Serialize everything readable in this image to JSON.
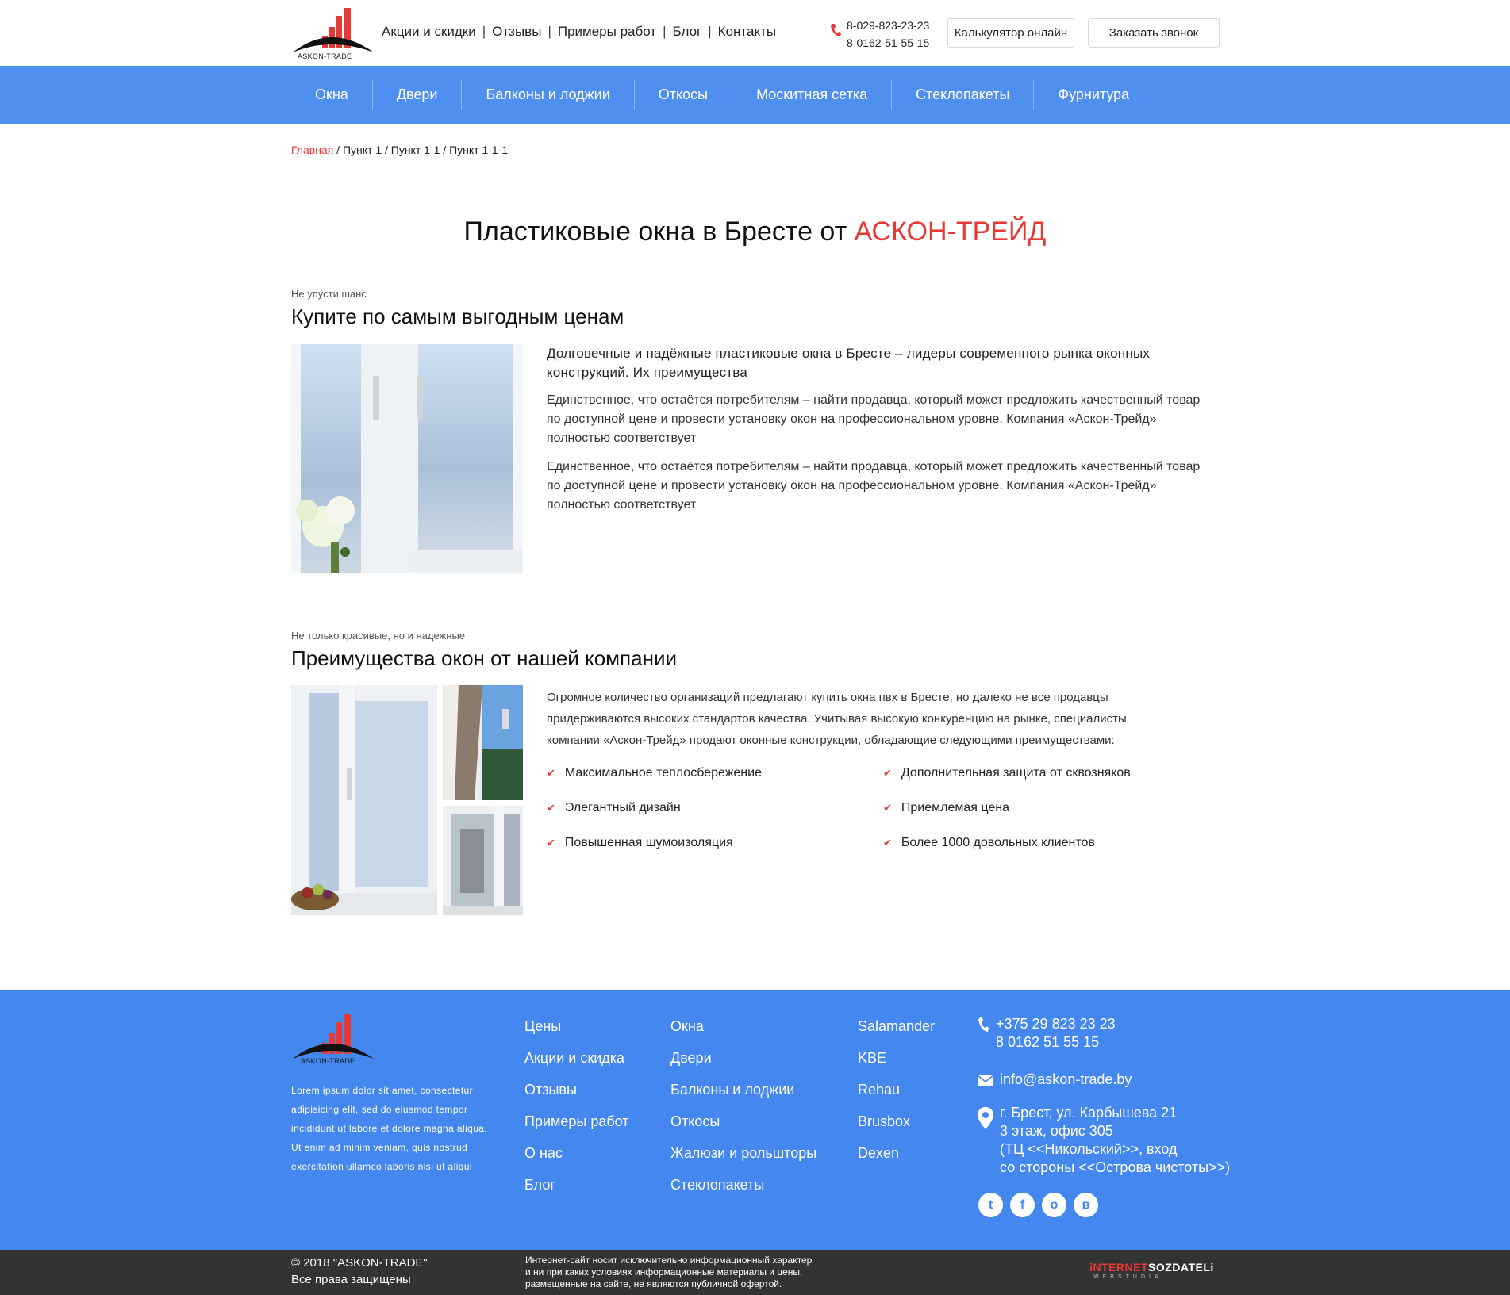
{
  "brand": {
    "logo_text": "ASKON-TRADE"
  },
  "header": {
    "top_links": [
      "Акции и скидки",
      "Отзывы",
      "Примеры работ",
      "Блог",
      "Контакты"
    ],
    "phones": [
      "8-029-823-23-23",
      "8-0162-51-55-15"
    ],
    "calc_button": "Калькулятор онлайн",
    "callback_button": "Заказать звонок"
  },
  "nav": [
    "Окна",
    "Двери",
    "Балконы и лоджии",
    "Откосы",
    "Москитная сетка",
    "Стеклопакеты",
    "Фурнитура"
  ],
  "breadcrumb": {
    "home": "Главная",
    "rest": " / Пункт 1 / Пункт 1-1 / Пункт 1-1-1"
  },
  "main": {
    "title": "Пластиковые окна в Бресте от ",
    "title_accent": "АСКОН-ТРЕЙД"
  },
  "section1": {
    "kicker": "Не упусти шанс",
    "title": "Купите по самым выгодным ценам",
    "lead": "Долговечные и надёжные пластиковые окна в Бресте – лидеры современного рынка оконных конструкций. Их преимущества",
    "p1": "Единственное, что остаётся потребителям – найти продавца, который может предложить качественный товар по доступной цене и провести установку окон на профессиональном уровне. Компания «Аскон-Трейд» полностью соответствует",
    "p2": "Единственное, что остаётся потребителям – найти продавца, который может предложить качественный товар по доступной цене и провести установку окон на профессиональном уровне. Компания «Аскон-Трейд» полностью соответствует"
  },
  "section2": {
    "kicker": "Не только красивые, но и надежные",
    "title": "Преимущества окон от нашей компании",
    "text": "Огромное количество организаций предлагают купить окна пвх в Бресте, но далеко не все продавцы придерживаются высоких стандартов качества. Учитывая высокую конкуренцию на рынке, специалисты компании «Аскон-Трейд» продают оконные конструкции, обладающие следующими преимуществами:",
    "advantages_left": [
      "Максимальное теплосбережение",
      "Элегантный дизайн",
      "Повышенная шумоизоляция"
    ],
    "advantages_right": [
      "Дополнительная защита от сквозняков",
      "Приемлемая цена",
      "Более 1000 довольных клиентов"
    ]
  },
  "footer": {
    "about": "Lorem ipsum dolor sit amet, consectetur adipisicing elit, sed do eiusmod tempor incididunt ut labore et dolore magna aliqua. Ut enim ad minim veniam, quis nostrud exercitation ullamco laboris nisi ut aliqui",
    "col1": [
      "Цены",
      "Акции и скидка",
      "Отзывы",
      "Примеры работ",
      "О нас",
      "Блог"
    ],
    "col2": [
      "Окна",
      "Двери",
      "Балконы и лоджии",
      "Откосы",
      "Жалюзи и рольшторы",
      "Стеклопакеты"
    ],
    "col3": [
      "Salamander",
      "KBE",
      "Rehau",
      "Brusbox",
      "Dexen"
    ],
    "phone1": "+375 29 823 23 23",
    "phone2": "8 0162 51 55 15",
    "email": "info@askon-trade.by",
    "address": [
      "г. Брест, ул. Карбышева 21",
      "3 этаж, офис 305",
      "(ТЦ <<Никольский>>, вход",
      "со стороны <<Острова чистоты>>)"
    ],
    "social_icons": [
      "twitter-icon",
      "facebook-icon",
      "odnoklassniki-icon",
      "vk-icon"
    ]
  },
  "bottom": {
    "copy1": "© 2018 \"ASKON-TRADE\"",
    "copy2": "Все права защищены",
    "disclaimer": [
      "Интернет-сайт носит исключительно информационный характер",
      "и ни при каких условиях информационные материалы и цены,",
      "размещенные на сайте, не являются публичной офертой."
    ],
    "studio_red": "iNTERNET",
    "studio_white": "SOZDATELi",
    "studio_sub": "WEBSTUDIA"
  },
  "colors": {
    "accent": "#e53935",
    "nav": "#4f8ff0",
    "footer": "#4487ee",
    "bottom": "#333333"
  }
}
